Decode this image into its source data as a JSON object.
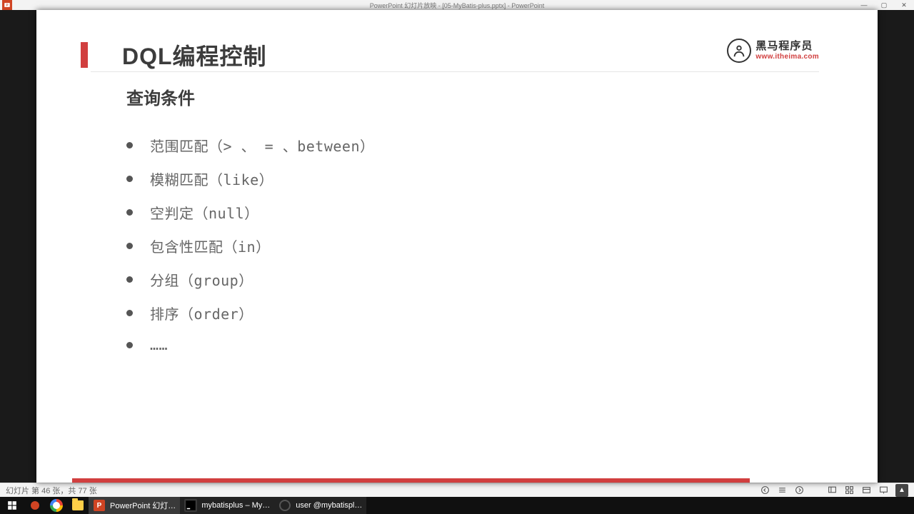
{
  "window": {
    "title": "PowerPoint 幻灯片放映 - [05-MyBatis-plus.pptx] - PowerPoint"
  },
  "slide": {
    "title": "DQL编程控制",
    "subtitle": "查询条件",
    "bullets": [
      "范围匹配（> 、 = 、between）",
      "模糊匹配（like）",
      "空判定（null）",
      "包含性匹配（in）",
      "分组（group）",
      "排序（order）",
      "……"
    ],
    "progress_percent": 88
  },
  "brand": {
    "name": "黑马程序员",
    "url": "www.itheima.com"
  },
  "statusbar": {
    "slide_counter": "幻灯片 第 46 张，共 77 张"
  },
  "taskbar": {
    "items": [
      {
        "label": "PowerPoint 幻灯…",
        "kind": "ppt",
        "active": true
      },
      {
        "label": "mybatisplus – My…",
        "kind": "idea",
        "active": false
      },
      {
        "label": "user @mybatispl…",
        "kind": "moba",
        "active": false
      }
    ]
  }
}
